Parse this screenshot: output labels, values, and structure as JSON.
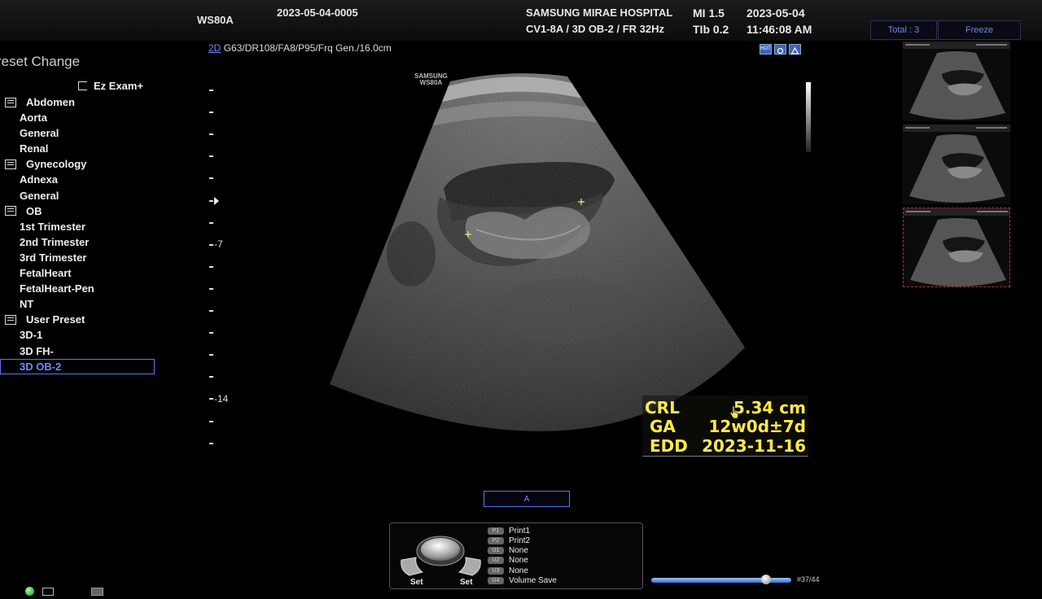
{
  "header": {
    "model": "WS80A",
    "patient_id": "2023-05-04-0005",
    "hospital": "SAMSUNG MIRAE HOSPITAL",
    "probe_info": "CV1-8A / 3D OB-2 / FR 32Hz",
    "mi": "MI  1.5",
    "tib": "TIb 0.2",
    "date": "2023-05-04",
    "time": "11:46:08 AM",
    "total_label": "Total : 3",
    "freeze_label": "Freeze"
  },
  "image_params": {
    "mode": "2D",
    "params": "G63/DR108/FA8/P95/Frq Gen./16.0cm",
    "watermark_line1": "SAMSUNG",
    "watermark_line2": "WS80A"
  },
  "preset": {
    "title": "reset Change",
    "ez_exam": "Ez Exam+",
    "items": [
      {
        "label": "Abdomen",
        "type": "category"
      },
      {
        "label": "Aorta",
        "type": "item"
      },
      {
        "label": "General",
        "type": "item"
      },
      {
        "label": "Renal",
        "type": "item"
      },
      {
        "label": "Gynecology",
        "type": "category"
      },
      {
        "label": "Adnexa",
        "type": "item"
      },
      {
        "label": "General",
        "type": "item"
      },
      {
        "label": "OB",
        "type": "category"
      },
      {
        "label": "1st Trimester",
        "type": "item"
      },
      {
        "label": "2nd Trimester",
        "type": "item"
      },
      {
        "label": "3rd Trimester",
        "type": "item"
      },
      {
        "label": "FetalHeart",
        "type": "item"
      },
      {
        "label": "FetalHeart-Pen",
        "type": "item"
      },
      {
        "label": "NT",
        "type": "item"
      },
      {
        "label": "User Preset",
        "type": "category"
      },
      {
        "label": "3D-1",
        "type": "item"
      },
      {
        "label": "3D FH-",
        "type": "item"
      },
      {
        "label": "3D OB-2",
        "type": "item",
        "selected": true
      }
    ]
  },
  "scale": {
    "depth_7": "7",
    "depth_14": "14"
  },
  "measurement": {
    "crl_label": "CRL",
    "crl_value": "5.34 cm",
    "ga_label": "GA",
    "ga_value": "12w0d±7d",
    "edd_label": "EDD",
    "edd_value": "2023-11-16",
    "color": "#ffe94a"
  },
  "annotation_label": "A",
  "controls": {
    "set_left": "Set",
    "set_right": "Set",
    "function_keys": [
      {
        "key": "P1",
        "label": "Print1"
      },
      {
        "key": "P2",
        "label": "Print2"
      },
      {
        "key": "U1",
        "label": "None"
      },
      {
        "key": "U2",
        "label": "None"
      },
      {
        "key": "U3",
        "label": "None"
      },
      {
        "key": "U4",
        "label": "Volume Save"
      }
    ]
  },
  "cine": {
    "counter": "#37/44",
    "position": 0.82
  },
  "icons": {
    "top_right": [
      "hot-icon",
      "probe-icon",
      "triangle-icon"
    ],
    "status": [
      "globe-icon",
      "monitor-icon",
      "disk-icon"
    ]
  }
}
